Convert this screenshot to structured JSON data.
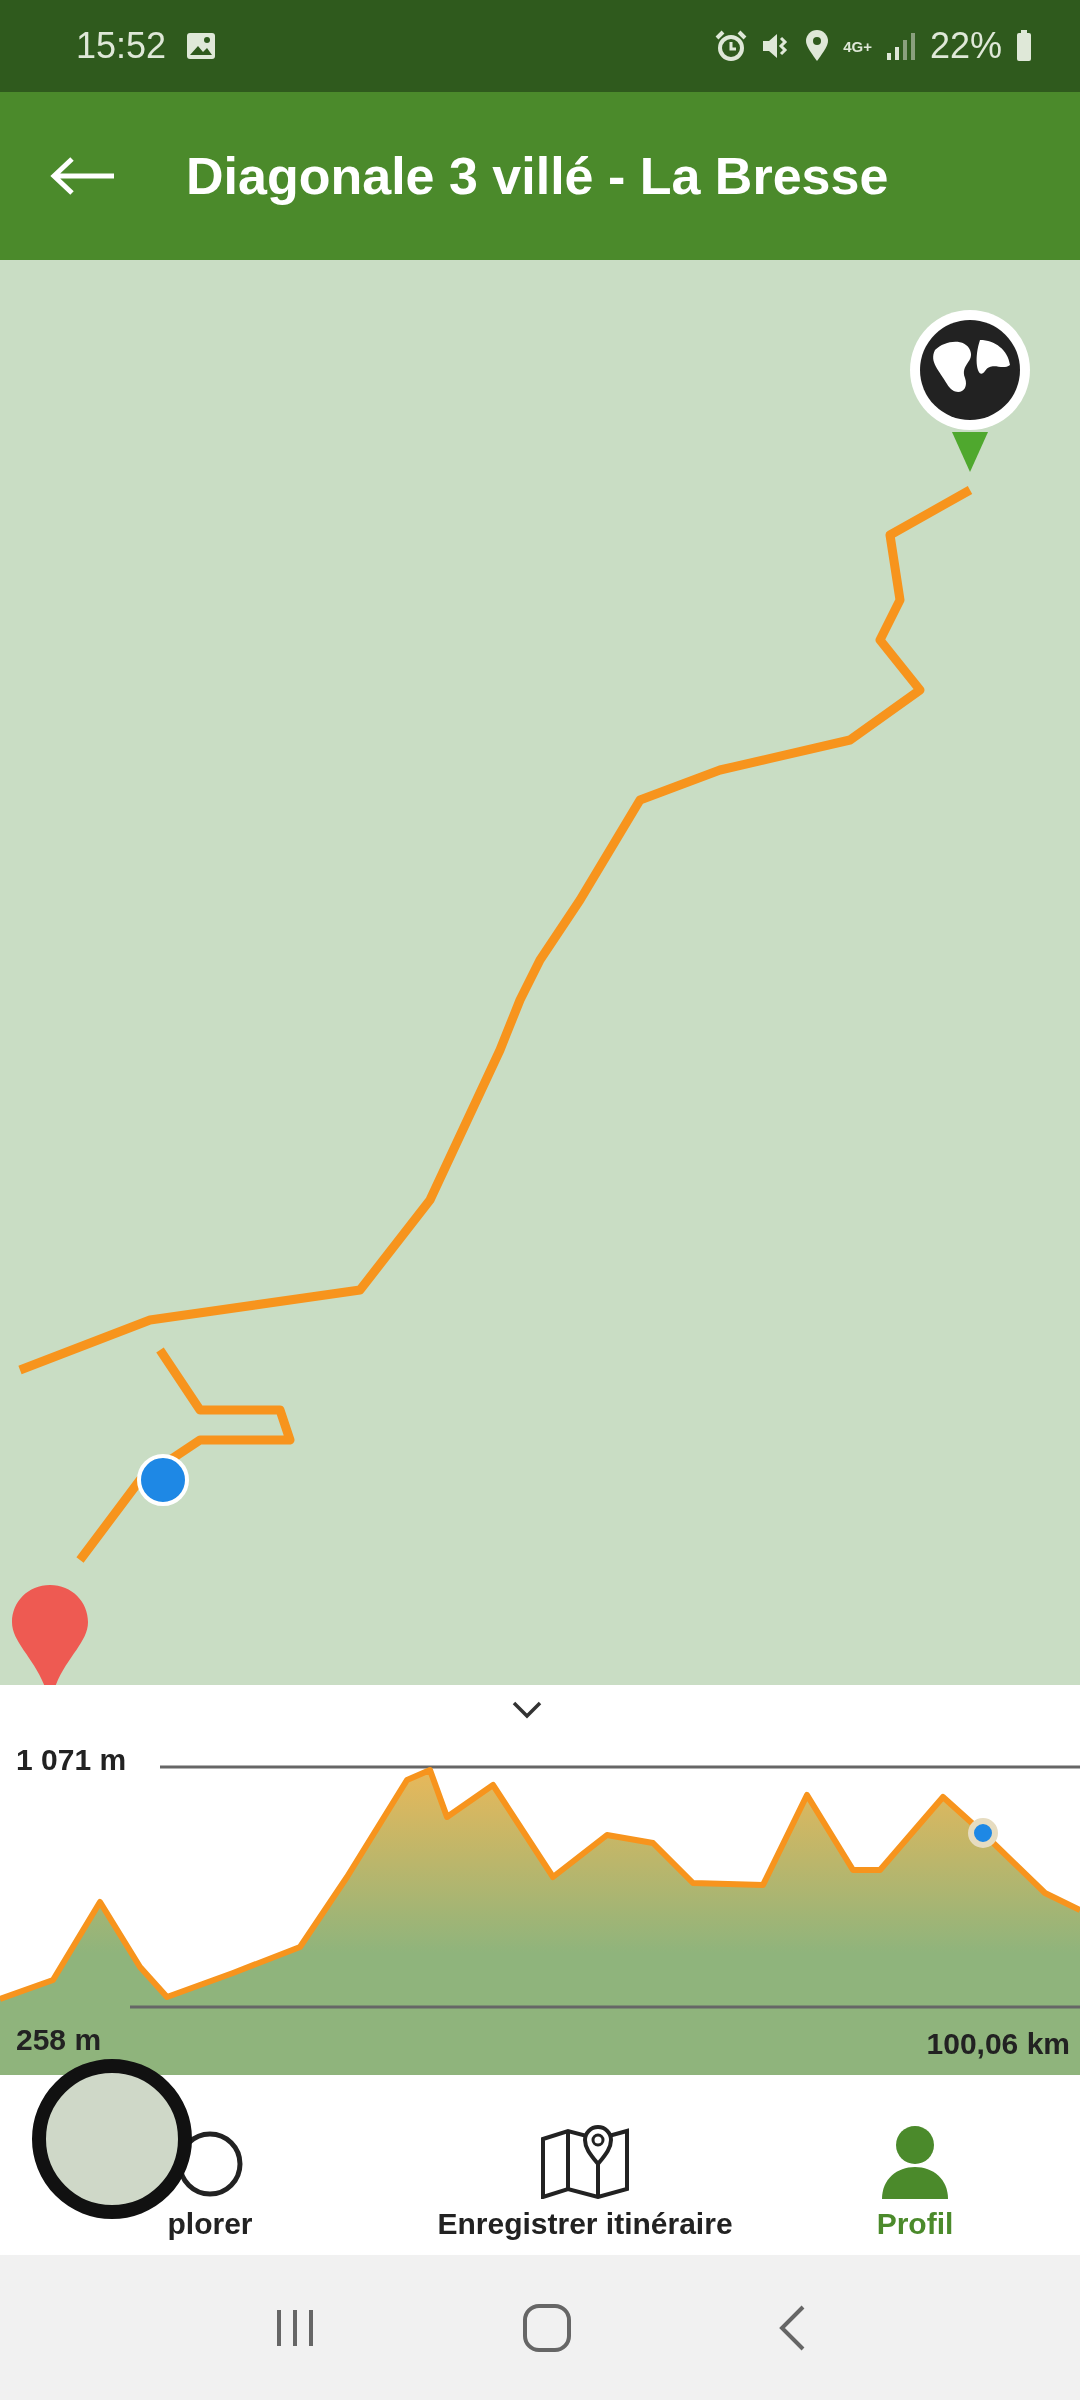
{
  "status_bar": {
    "time": "15:52",
    "network": "4G+",
    "battery": "22%"
  },
  "app_bar": {
    "title": "Diagonale 3 villé - La Bresse"
  },
  "elevation": {
    "max_label": "1 071 m",
    "min_label": "258 m",
    "distance_label": "100,06 km"
  },
  "nav": [
    {
      "kind": "explore",
      "label": "plorer",
      "selected": false
    },
    {
      "kind": "record",
      "label": "Enregistrer itinéraire",
      "selected": false
    },
    {
      "kind": "profile",
      "label": "Profil",
      "selected": true
    }
  ]
}
